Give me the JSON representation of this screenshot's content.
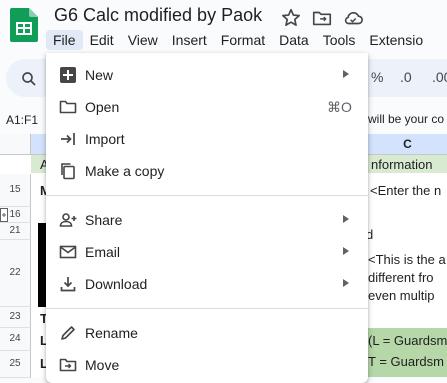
{
  "app": {
    "title": "G6 Calc modified by Paok",
    "menus": [
      "File",
      "Edit",
      "View",
      "Insert",
      "Format",
      "Data",
      "Tools",
      "Extensio"
    ],
    "active_menu": "File"
  },
  "toolbar": {
    "percent": "%",
    "decimal_decrease": ".0",
    "decimal_increase": ".00"
  },
  "formula_bar": {
    "name_box": "A1:F1",
    "formula_text": "will be your co"
  },
  "grid": {
    "column_c": "C",
    "row_numbers": [
      "15",
      "16",
      "21",
      "22",
      "23",
      "24",
      "25"
    ],
    "cells": {
      "a_header": "A",
      "c_header_info": "nformation",
      "row15_a": "M",
      "row15_c": "<Enter the n",
      "row21_c": "d",
      "row22_c1": "<This is the a",
      "row22_c2": "different fro",
      "row22_c3": "even multip",
      "row23_a": "T",
      "row24_a": "L",
      "row24_c": "(L = Guardsm",
      "row25_a": "L",
      "row25_c": "T = Guardsm"
    }
  },
  "file_menu": {
    "items": [
      {
        "label": "New",
        "icon": "new-icon",
        "submenu": true
      },
      {
        "label": "Open",
        "icon": "folder-icon",
        "shortcut": "⌘O"
      },
      {
        "label": "Import",
        "icon": "import-icon"
      },
      {
        "label": "Make a copy",
        "icon": "copy-icon"
      },
      {
        "label": "Share",
        "icon": "share-person-icon",
        "submenu": true
      },
      {
        "label": "Email",
        "icon": "email-icon",
        "submenu": true
      },
      {
        "label": "Download",
        "icon": "download-icon",
        "submenu": true
      },
      {
        "label": "Rename",
        "icon": "pencil-icon"
      },
      {
        "label": "Move",
        "icon": "move-folder-icon"
      }
    ]
  },
  "colors": {
    "sheets_green": "#0f9d58",
    "menu_active_bg": "#e1e9f7",
    "header_selected": "#d3e3fd",
    "green_cell": "#d9ead3",
    "light_green": "#b6d7a8"
  }
}
